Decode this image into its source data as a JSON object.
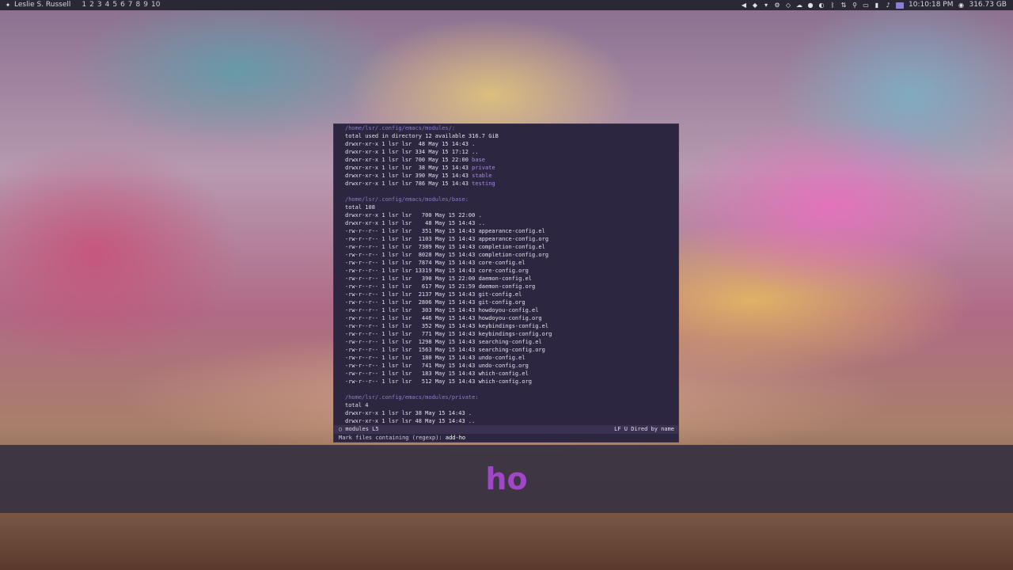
{
  "topbar": {
    "user": "Leslie S. Russell",
    "workspaces": [
      "1",
      "2",
      "3",
      "4",
      "5",
      "6",
      "7",
      "8",
      "9",
      "10"
    ],
    "clock": "10:10:18 PM",
    "disk": "316.73 GB"
  },
  "emacs": {
    "lines": [
      {
        "t": "/home/lsr/.config/emacs/modules/:",
        "c": "hdr"
      },
      {
        "t": "total used in directory 12 available 316.7 GiB"
      },
      {
        "t": "drwxr-xr-x 1 lsr lsr  48 May 15 14:43 ."
      },
      {
        "t": "drwxr-xr-x 1 lsr lsr 334 May 15 17:12 .."
      },
      {
        "t": "drwxr-xr-x 1 lsr lsr 700 May 15 22:00 ",
        "d": "base"
      },
      {
        "t": "drwxr-xr-x 1 lsr lsr  38 May 15 14:43 ",
        "d": "private"
      },
      {
        "t": "drwxr-xr-x 1 lsr lsr 390 May 15 14:43 ",
        "d": "stable"
      },
      {
        "t": "drwxr-xr-x 1 lsr lsr 786 May 15 14:43 ",
        "d": "testing"
      },
      {
        "t": ""
      },
      {
        "t": "/home/lsr/.config/emacs/modules/base:",
        "c": "hdr"
      },
      {
        "t": "total 108"
      },
      {
        "t": "drwxr-xr-x 1 lsr lsr   700 May 15 22:00 ."
      },
      {
        "t": "drwxr-xr-x 1 lsr lsr    48 May 15 14:43 .."
      },
      {
        "t": "-rw-r--r-- 1 lsr lsr   351 May 15 14:43 appearance-config.el"
      },
      {
        "t": "-rw-r--r-- 1 lsr lsr  1103 May 15 14:43 appearance-config.org"
      },
      {
        "t": "-rw-r--r-- 1 lsr lsr  7389 May 15 14:43 completion-config.el"
      },
      {
        "t": "-rw-r--r-- 1 lsr lsr  8028 May 15 14:43 completion-config.org"
      },
      {
        "t": "-rw-r--r-- 1 lsr lsr  7874 May 15 14:43 core-config.el"
      },
      {
        "t": "-rw-r--r-- 1 lsr lsr 13319 May 15 14:43 core-config.org"
      },
      {
        "t": "-rw-r--r-- 1 lsr lsr   390 May 15 22:00 daemon-config.el"
      },
      {
        "t": "-rw-r--r-- 1 lsr lsr   617 May 15 21:59 daemon-config.org"
      },
      {
        "t": "-rw-r--r-- 1 lsr lsr  2137 May 15 14:43 git-config.el"
      },
      {
        "t": "-rw-r--r-- 1 lsr lsr  2806 May 15 14:43 git-config.org"
      },
      {
        "t": "-rw-r--r-- 1 lsr lsr   303 May 15 14:43 howdoyou-config.el"
      },
      {
        "t": "-rw-r--r-- 1 lsr lsr   446 May 15 14:43 howdoyou-config.org"
      },
      {
        "t": "-rw-r--r-- 1 lsr lsr   352 May 15 14:43 keybindings-config.el"
      },
      {
        "t": "-rw-r--r-- 1 lsr lsr   771 May 15 14:43 keybindings-config.org"
      },
      {
        "t": "-rw-r--r-- 1 lsr lsr  1298 May 15 14:43 searching-config.el"
      },
      {
        "t": "-rw-r--r-- 1 lsr lsr  1563 May 15 14:43 searching-config.org"
      },
      {
        "t": "-rw-r--r-- 1 lsr lsr   180 May 15 14:43 undo-config.el"
      },
      {
        "t": "-rw-r--r-- 1 lsr lsr   741 May 15 14:43 undo-config.org"
      },
      {
        "t": "-rw-r--r-- 1 lsr lsr   183 May 15 14:43 which-config.el"
      },
      {
        "t": "-rw-r--r-- 1 lsr lsr   512 May 15 14:43 which-config.org"
      },
      {
        "t": ""
      },
      {
        "t": "/home/lsr/.config/emacs/modules/private:",
        "c": "hdr"
      },
      {
        "t": "total 4"
      },
      {
        "t": "drwxr-xr-x 1 lsr lsr 38 May 15 14:43 ."
      },
      {
        "t": "drwxr-xr-x 1 lsr lsr 48 May 15 14:43 .."
      }
    ],
    "modeline": {
      "left": "○ modules L5",
      "right": "LF U Dired by name"
    },
    "minibuffer": {
      "prompt": "Mark files containing (regexp): ",
      "value": "add-ho"
    }
  },
  "keycast": {
    "text": "ho"
  },
  "colors": {
    "accent": "#a046c8",
    "dir": "#a58be6",
    "header": "#8a7fc7"
  }
}
